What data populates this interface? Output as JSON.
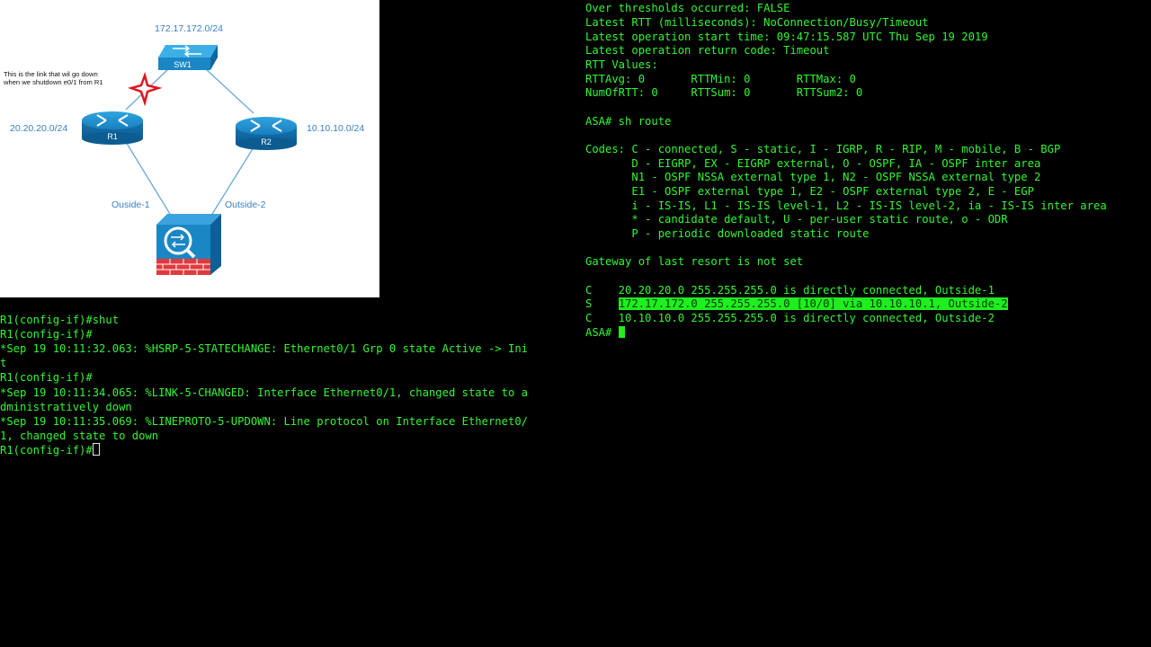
{
  "diagram": {
    "net_top": "172.17.172.0/24",
    "net_left": "20.20.20.0/24",
    "net_right": "10.10.10.0/24",
    "sw_label": "SW1",
    "r1_label": "R1",
    "r2_label": "R2",
    "outside1": "Ouside-1",
    "outside2": "Outside-2",
    "note_line1": "This is the link that wil go down",
    "note_line2": "when we shutdown e0/1 from R1"
  },
  "left_terminal": {
    "lines": [
      "R1(config-if)#shut",
      "R1(config-if)#",
      "*Sep 19 10:11:32.063: %HSRP-5-STATECHANGE: Ethernet0/1 Grp 0 state Active -> Ini",
      "t",
      "R1(config-if)#",
      "*Sep 19 10:11:34.065: %LINK-5-CHANGED: Interface Ethernet0/1, changed state to a",
      "dministratively down",
      "*Sep 19 10:11:35.069: %LINEPROTO-5-UPDOWN: Line protocol on Interface Ethernet0/",
      "1, changed state to down"
    ],
    "prompt": "R1(config-if)#"
  },
  "right_terminal": {
    "lines": [
      "Over thresholds occurred: FALSE",
      "Latest RTT (milliseconds): NoConnection/Busy/Timeout",
      "Latest operation start time: 09:47:15.587 UTC Thu Sep 19 2019",
      "Latest operation return code: Timeout",
      "RTT Values:",
      "RTTAvg: 0       RTTMin: 0       RTTMax: 0",
      "NumOfRTT: 0     RTTSum: 0       RTTSum2: 0",
      "",
      "ASA# sh route",
      "",
      "Codes: C - connected, S - static, I - IGRP, R - RIP, M - mobile, B - BGP",
      "       D - EIGRP, EX - EIGRP external, O - OSPF, IA - OSPF inter area",
      "       N1 - OSPF NSSA external type 1, N2 - OSPF NSSA external type 2",
      "       E1 - OSPF external type 1, E2 - OSPF external type 2, E - EGP",
      "       i - IS-IS, L1 - IS-IS level-1, L2 - IS-IS level-2, ia - IS-IS inter area",
      "       * - candidate default, U - per-user static route, o - ODR",
      "       P - periodic downloaded static route",
      "",
      "Gateway of last resort is not set",
      ""
    ],
    "route_c1": "C    20.20.20.0 255.255.255.0 is directly connected, Outside-1",
    "route_s_code": "S    ",
    "route_s_text": "172.17.172.0 255.255.255.0 [10/0] via 10.10.10.1, Outside-2",
    "route_c2": "C    10.10.10.0 255.255.255.0 is directly connected, Outside-2",
    "prompt": "ASA# "
  },
  "colors": {
    "terminal_text": "#33f533",
    "highlight": "#1eef1e",
    "link_line": "#6aa8d8",
    "router": "#1b86c4",
    "label_blue": "#3a7fc1"
  }
}
